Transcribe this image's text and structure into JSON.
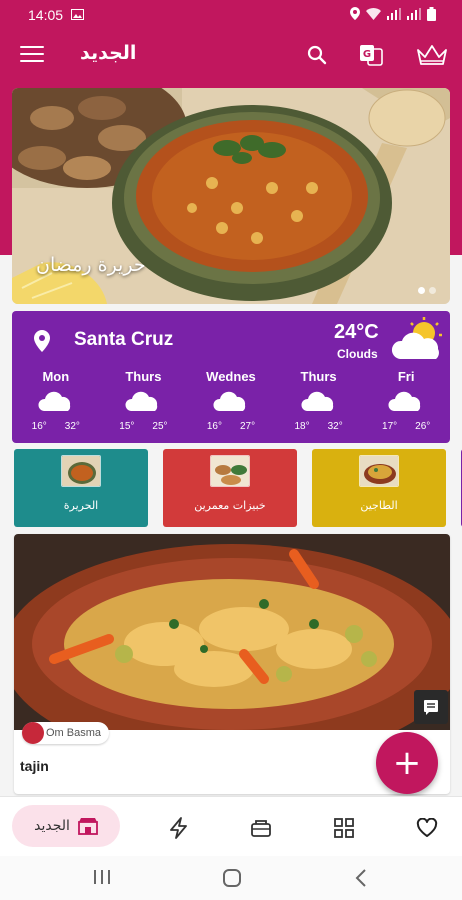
{
  "status": {
    "time": "14:05"
  },
  "toolbar": {
    "title": "الجديد"
  },
  "hero": {
    "caption": "حريرة رمضان",
    "slides": 2,
    "active_slide": 1
  },
  "weather": {
    "city": "Santa Cruz",
    "temperature": "24°C",
    "condition": "Clouds",
    "days": [
      {
        "name": "Mon",
        "low": "16°",
        "high": "32°"
      },
      {
        "name": "Thurs",
        "low": "15°",
        "high": "25°"
      },
      {
        "name": "Wednes",
        "low": "16°",
        "high": "27°"
      },
      {
        "name": "Thurs",
        "low": "18°",
        "high": "32°"
      },
      {
        "name": "Fri",
        "low": "17°",
        "high": "26°"
      }
    ]
  },
  "categories": [
    {
      "label": "الحريرة",
      "color": "#1e8c8c"
    },
    {
      "label": "خبيزات معمرين",
      "color": "#d23a3a"
    },
    {
      "label": "الطاجين",
      "color": "#d9b10f"
    }
  ],
  "recipe": {
    "author": "Om Basma",
    "title": "tajin"
  },
  "fab": {
    "label": "+"
  },
  "bottom_nav": {
    "active_label": "الجديد"
  },
  "colors": {
    "primary": "#c1175e",
    "weather": "#7a22a8"
  }
}
